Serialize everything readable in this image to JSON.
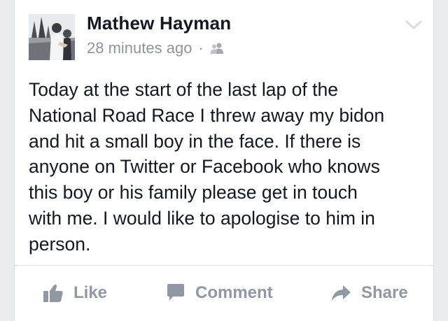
{
  "post": {
    "author": "Mathew Hayman",
    "time": "28 minutes ago",
    "separator": "·",
    "audience_icon": "friends-icon",
    "menu_icon": "chevron-down-icon",
    "text": "Today at the start of the last lap of the\nNational Road Race  I threw away my bidon\nand hit a small boy in the face. If there is\nanyone on Twitter or Facebook who knows\nthis boy or his family please get in touch\nwith me. I would like to apologise to him in\nperson."
  },
  "actions": {
    "like_label": "Like",
    "like_icon": "thumbs-up-icon",
    "comment_label": "Comment",
    "comment_icon": "speech-bubble-icon",
    "share_label": "Share",
    "share_icon": "share-arrow-icon"
  },
  "colors": {
    "text": "#141823",
    "muted": "#90949c",
    "action": "#9197a3",
    "background": "#e9ebee"
  }
}
